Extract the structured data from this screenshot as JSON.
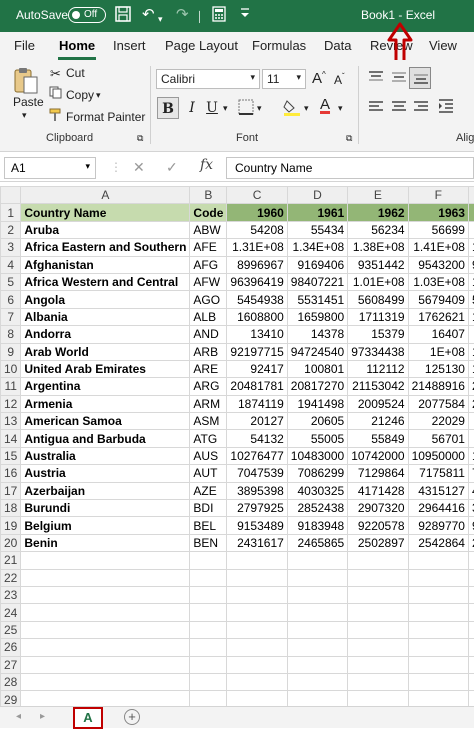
{
  "titlebar": {
    "autosave_label": "AutoSave",
    "autosave_state": "Off",
    "title": "Book1  -  Excel"
  },
  "tabs": [
    "File",
    "Home",
    "Insert",
    "Page Layout",
    "Formulas",
    "Data",
    "Review",
    "View"
  ],
  "ribbon": {
    "paste_label": "Paste",
    "cut_label": "Cut",
    "copy_label": "Copy",
    "format_painter_label": "Format Painter",
    "clipboard_group": "Clipboard",
    "font_name": "Calibri",
    "font_size": "11",
    "font_group": "Font",
    "alignment_group": "Alig",
    "bold": "B",
    "italic": "I",
    "underline": "U"
  },
  "formula_bar": {
    "name_box": "A1",
    "fx": "fx",
    "content": "Country Name"
  },
  "columns": [
    "A",
    "B",
    "C",
    "D",
    "E",
    "F"
  ],
  "header_row": {
    "name": "Country Name",
    "code": "Code",
    "years": [
      "1960",
      "1961",
      "1962",
      "1963"
    ]
  },
  "rows": [
    {
      "name": "Aruba",
      "code": "ABW",
      "vals": [
        "54208",
        "55434",
        "56234",
        "56699"
      ],
      "more": ""
    },
    {
      "name": "Africa Eastern and Southern",
      "code": "AFE",
      "vals": [
        "1.31E+08",
        "1.34E+08",
        "1.38E+08",
        "1.41E+08"
      ],
      "more": "1"
    },
    {
      "name": "Afghanistan",
      "code": "AFG",
      "vals": [
        "8996967",
        "9169406",
        "9351442",
        "9543200"
      ],
      "more": "9"
    },
    {
      "name": "Africa Western and Central",
      "code": "AFW",
      "vals": [
        "96396419",
        "98407221",
        "1.01E+08",
        "1.03E+08"
      ],
      "more": "1.0"
    },
    {
      "name": "Angola",
      "code": "AGO",
      "vals": [
        "5454938",
        "5531451",
        "5608499",
        "5679409"
      ],
      "more": "5"
    },
    {
      "name": "Albania",
      "code": "ALB",
      "vals": [
        "1608800",
        "1659800",
        "1711319",
        "1762621"
      ],
      "more": "1"
    },
    {
      "name": "Andorra",
      "code": "AND",
      "vals": [
        "13410",
        "14378",
        "15379",
        "16407"
      ],
      "more": ""
    },
    {
      "name": "Arab World",
      "code": "ARB",
      "vals": [
        "92197715",
        "94724540",
        "97334438",
        "1E+08"
      ],
      "more": "1"
    },
    {
      "name": "United Arab Emirates",
      "code": "ARE",
      "vals": [
        "92417",
        "100801",
        "112112",
        "125130"
      ],
      "more": "1"
    },
    {
      "name": "Argentina",
      "code": "ARG",
      "vals": [
        "20481781",
        "20817270",
        "21153042",
        "21488916"
      ],
      "more": "2"
    },
    {
      "name": "Armenia",
      "code": "ARM",
      "vals": [
        "1874119",
        "1941498",
        "2009524",
        "2077584"
      ],
      "more": "2"
    },
    {
      "name": "American Samoa",
      "code": "ASM",
      "vals": [
        "20127",
        "20605",
        "21246",
        "22029"
      ],
      "more": ""
    },
    {
      "name": "Antigua and Barbuda",
      "code": "ATG",
      "vals": [
        "54132",
        "55005",
        "55849",
        "56701"
      ],
      "more": ""
    },
    {
      "name": "Australia",
      "code": "AUS",
      "vals": [
        "10276477",
        "10483000",
        "10742000",
        "10950000"
      ],
      "more": "1"
    },
    {
      "name": "Austria",
      "code": "AUT",
      "vals": [
        "7047539",
        "7086299",
        "7129864",
        "7175811"
      ],
      "more": "7"
    },
    {
      "name": "Azerbaijan",
      "code": "AZE",
      "vals": [
        "3895398",
        "4030325",
        "4171428",
        "4315127"
      ],
      "more": "4"
    },
    {
      "name": "Burundi",
      "code": "BDI",
      "vals": [
        "2797925",
        "2852438",
        "2907320",
        "2964416"
      ],
      "more": "3"
    },
    {
      "name": "Belgium",
      "code": "BEL",
      "vals": [
        "9153489",
        "9183948",
        "9220578",
        "9289770"
      ],
      "more": "9"
    },
    {
      "name": "Benin",
      "code": "BEN",
      "vals": [
        "2431617",
        "2465865",
        "2502897",
        "2542864"
      ],
      "more": "2"
    }
  ],
  "row_numbers": [
    "1",
    "2",
    "3",
    "4",
    "5",
    "6",
    "7",
    "8",
    "9",
    "10",
    "11",
    "12",
    "13",
    "14",
    "15",
    "16",
    "17",
    "18",
    "19",
    "20",
    "21",
    "22",
    "23",
    "24",
    "25",
    "26",
    "27",
    "28",
    "29"
  ],
  "sheet_tab": "A",
  "colors": {
    "excel_green": "#217346",
    "header_fill": "#c6dbae",
    "year_fill": "#93b676",
    "annotation_red": "#c00000"
  }
}
